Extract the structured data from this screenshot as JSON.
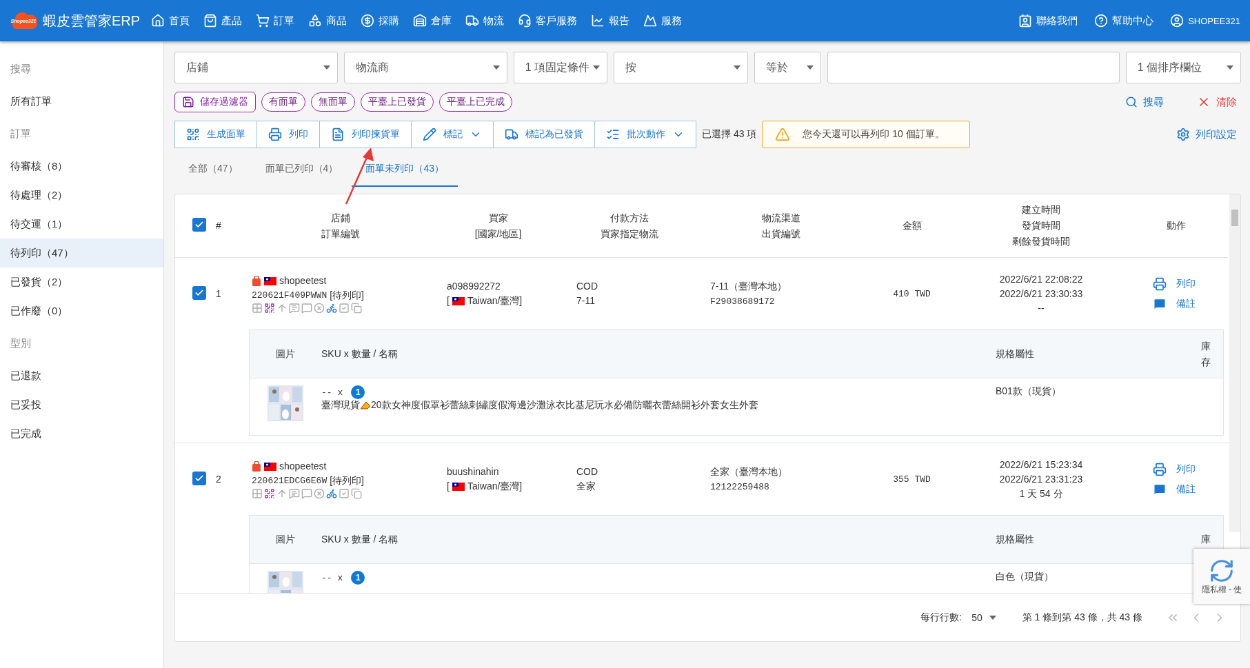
{
  "app": {
    "title": "蝦皮雲管家ERP",
    "logo_text": "Shopee321"
  },
  "nav": [
    {
      "label": "首頁"
    },
    {
      "label": "產品"
    },
    {
      "label": "訂單"
    },
    {
      "label": "商品"
    },
    {
      "label": "採購"
    },
    {
      "label": "倉庫"
    },
    {
      "label": "物流"
    },
    {
      "label": "客戶服務"
    },
    {
      "label": "報告"
    },
    {
      "label": "服務"
    }
  ],
  "nav_right": [
    {
      "label": "聯絡我們"
    },
    {
      "label": "幫助中心"
    },
    {
      "label": "SHOPEE321"
    }
  ],
  "sidebar": [
    {
      "heading": "搜尋",
      "items": [
        {
          "label": "所有訂單",
          "selected": false
        }
      ]
    },
    {
      "heading": "訂單",
      "items": [
        {
          "label": "待審核（8）",
          "selected": false
        },
        {
          "label": "待處理（2）",
          "selected": false
        },
        {
          "label": "待交運（1）",
          "selected": false
        },
        {
          "label": "待列印（47）",
          "selected": true
        },
        {
          "label": "已發貨（2）",
          "selected": false
        },
        {
          "label": "已作廢（0）",
          "selected": false
        }
      ]
    },
    {
      "heading": "型別",
      "items": [
        {
          "label": "已退款",
          "selected": false
        },
        {
          "label": "已妥投",
          "selected": false
        },
        {
          "label": "已完成",
          "selected": false
        }
      ]
    }
  ],
  "filters": [
    {
      "kind": "select",
      "label": "店鋪"
    },
    {
      "kind": "select",
      "label": "物流商"
    },
    {
      "kind": "select",
      "label": "1 項固定條件"
    },
    {
      "kind": "select",
      "label": "按"
    },
    {
      "kind": "select",
      "label": "等於"
    },
    {
      "kind": "input"
    },
    {
      "kind": "select",
      "label": "1 個排序欄位"
    }
  ],
  "save_filter": "儲存過濾器",
  "chips": [
    "有面單",
    "無面單",
    "平臺上已發貨",
    "平臺上已完成"
  ],
  "search_button": "搜尋",
  "clear_button": "清除",
  "actions": [
    {
      "label": "生成面單",
      "dropdown": false
    },
    {
      "label": "列印",
      "dropdown": false
    },
    {
      "label": "列印揀貨單",
      "dropdown": false
    },
    {
      "label": "標記",
      "dropdown": true
    },
    {
      "label": "標記為已發貨",
      "dropdown": false
    },
    {
      "label": "批次動作",
      "dropdown": true
    }
  ],
  "selected_count": "已選擇 43 項",
  "warning": "您今天還可以再列印 10 個訂單。",
  "print_settings": "列印設定",
  "tabs": [
    {
      "label": "全部（47）",
      "selected": false
    },
    {
      "label": "面單已列印（4）",
      "selected": false
    },
    {
      "label": "面單未列印（43）",
      "selected": true
    }
  ],
  "table": {
    "all_checked": true,
    "columns": [
      {
        "lines": [
          "#"
        ]
      },
      {
        "lines": [
          "店鋪",
          "訂單編號"
        ]
      },
      {
        "lines": [
          "買家",
          "[國家/地區]"
        ]
      },
      {
        "lines": [
          "付款方法",
          "買家指定物流"
        ]
      },
      {
        "lines": [
          "物流渠道",
          "出貨編號"
        ]
      },
      {
        "lines": [
          "金額"
        ]
      },
      {
        "lines": [
          "建立時間",
          "發貨時間",
          "剩餘發貨時間"
        ]
      },
      {
        "lines": [
          "動作"
        ]
      }
    ],
    "rows": [
      {
        "checked": true,
        "index": "1",
        "shop": "shopeetest",
        "order_no": "220621F409PWWN",
        "status": "[待列印]",
        "buyer": "a098992272",
        "region_open": "[",
        "region": "Taiwan/臺灣]",
        "payment": "COD",
        "buyer_logistics": "7-11",
        "channel": "7-11（臺灣本地）",
        "tracking": "F29038689172",
        "amount": "410 TWD",
        "created": "2022/6/21 22:08:22",
        "shipped": "2022/6/21 23:30:33",
        "remaining": "--",
        "row_actions": [
          "列印",
          "備註"
        ],
        "item_columns": [
          "圖片",
          "SKU x 數量 / 名稱",
          "規格屬性",
          "庫存"
        ],
        "items": [
          {
            "sku": "-- x",
            "qty": "1",
            "name_prefix": "臺灣現貨",
            "name": "20款女神度假罩衫蕾絲刺繡度假海邊沙灘泳衣比基尼玩水必備防曬衣蕾絲開衫外套女生外套",
            "spec": "B01款（現貨）"
          }
        ]
      },
      {
        "checked": true,
        "index": "2",
        "shop": "shopeetest",
        "order_no": "220621EDCG6E6W",
        "status": "[待列印]",
        "buyer": "buushinahin",
        "region_open": "[",
        "region": "Taiwan/臺灣]",
        "payment": "COD",
        "buyer_logistics": "全家",
        "channel": "全家（臺灣本地）",
        "tracking": "12122259488",
        "amount": "355 TWD",
        "created": "2022/6/21 15:23:34",
        "shipped": "2022/6/21 23:31:23",
        "remaining": "1 天 54 分",
        "row_actions": [
          "列印",
          "備註"
        ],
        "item_columns": [
          "圖片",
          "SKU x 數量 / 名稱",
          "規格屬性",
          "庫"
        ],
        "items": [
          {
            "sku": "-- x",
            "qty": "1",
            "spec": "白色（現貨）"
          }
        ]
      }
    ]
  },
  "footer": {
    "rows_label": "每行行數:",
    "rows_value": "50",
    "range": "第 1 條到第 43 條，共 43 條"
  },
  "recaptcha": {
    "text": "隱私權 - 使"
  }
}
